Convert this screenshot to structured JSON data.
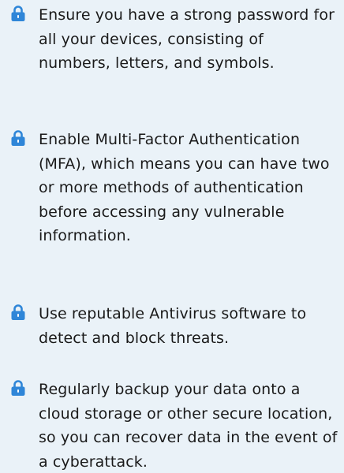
{
  "accent_color": "#2f86d8",
  "icon": "padlock-icon",
  "tips": [
    {
      "text": "Ensure you have a strong password for all your devices, consisting of numbers, letters, and symbols."
    },
    {
      "text": "Enable Multi-Factor Authentication (MFA), which means you can have two or more methods of authentication before accessing any vulnerable information."
    },
    {
      "text": "Use reputable Antivirus software to detect and block threats."
    },
    {
      "text": "Regularly backup your data onto a cloud storage or other secure location, so you can recover data in the event of a cyberattack."
    }
  ]
}
